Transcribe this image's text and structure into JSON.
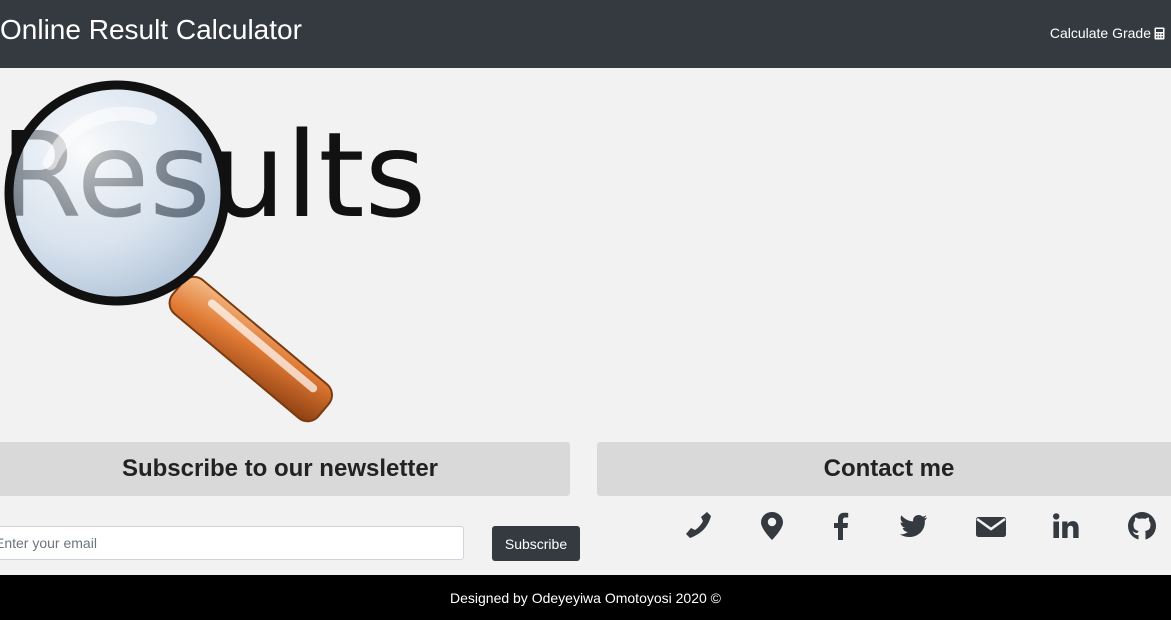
{
  "navbar": {
    "brand": "Online Result Calculator",
    "link_label": "Calculate Grade",
    "link_icon": "calculator-icon",
    "background": "#343a40"
  },
  "hero": {
    "word": "Results",
    "icon": "magnifying-glass-icon"
  },
  "newsletter": {
    "heading": "Subscribe to our newsletter",
    "email_placeholder": "Enter your email",
    "email_value": "",
    "button_label": "Subscribe"
  },
  "contact": {
    "heading": "Contact me",
    "icons": [
      "phone-icon",
      "map-marker-icon",
      "facebook-icon",
      "twitter-icon",
      "envelope-icon",
      "linkedin-icon",
      "github-icon"
    ]
  },
  "footer": {
    "text": "Designed by Odeyeyiwa Omotoyosi 2020 ©"
  }
}
